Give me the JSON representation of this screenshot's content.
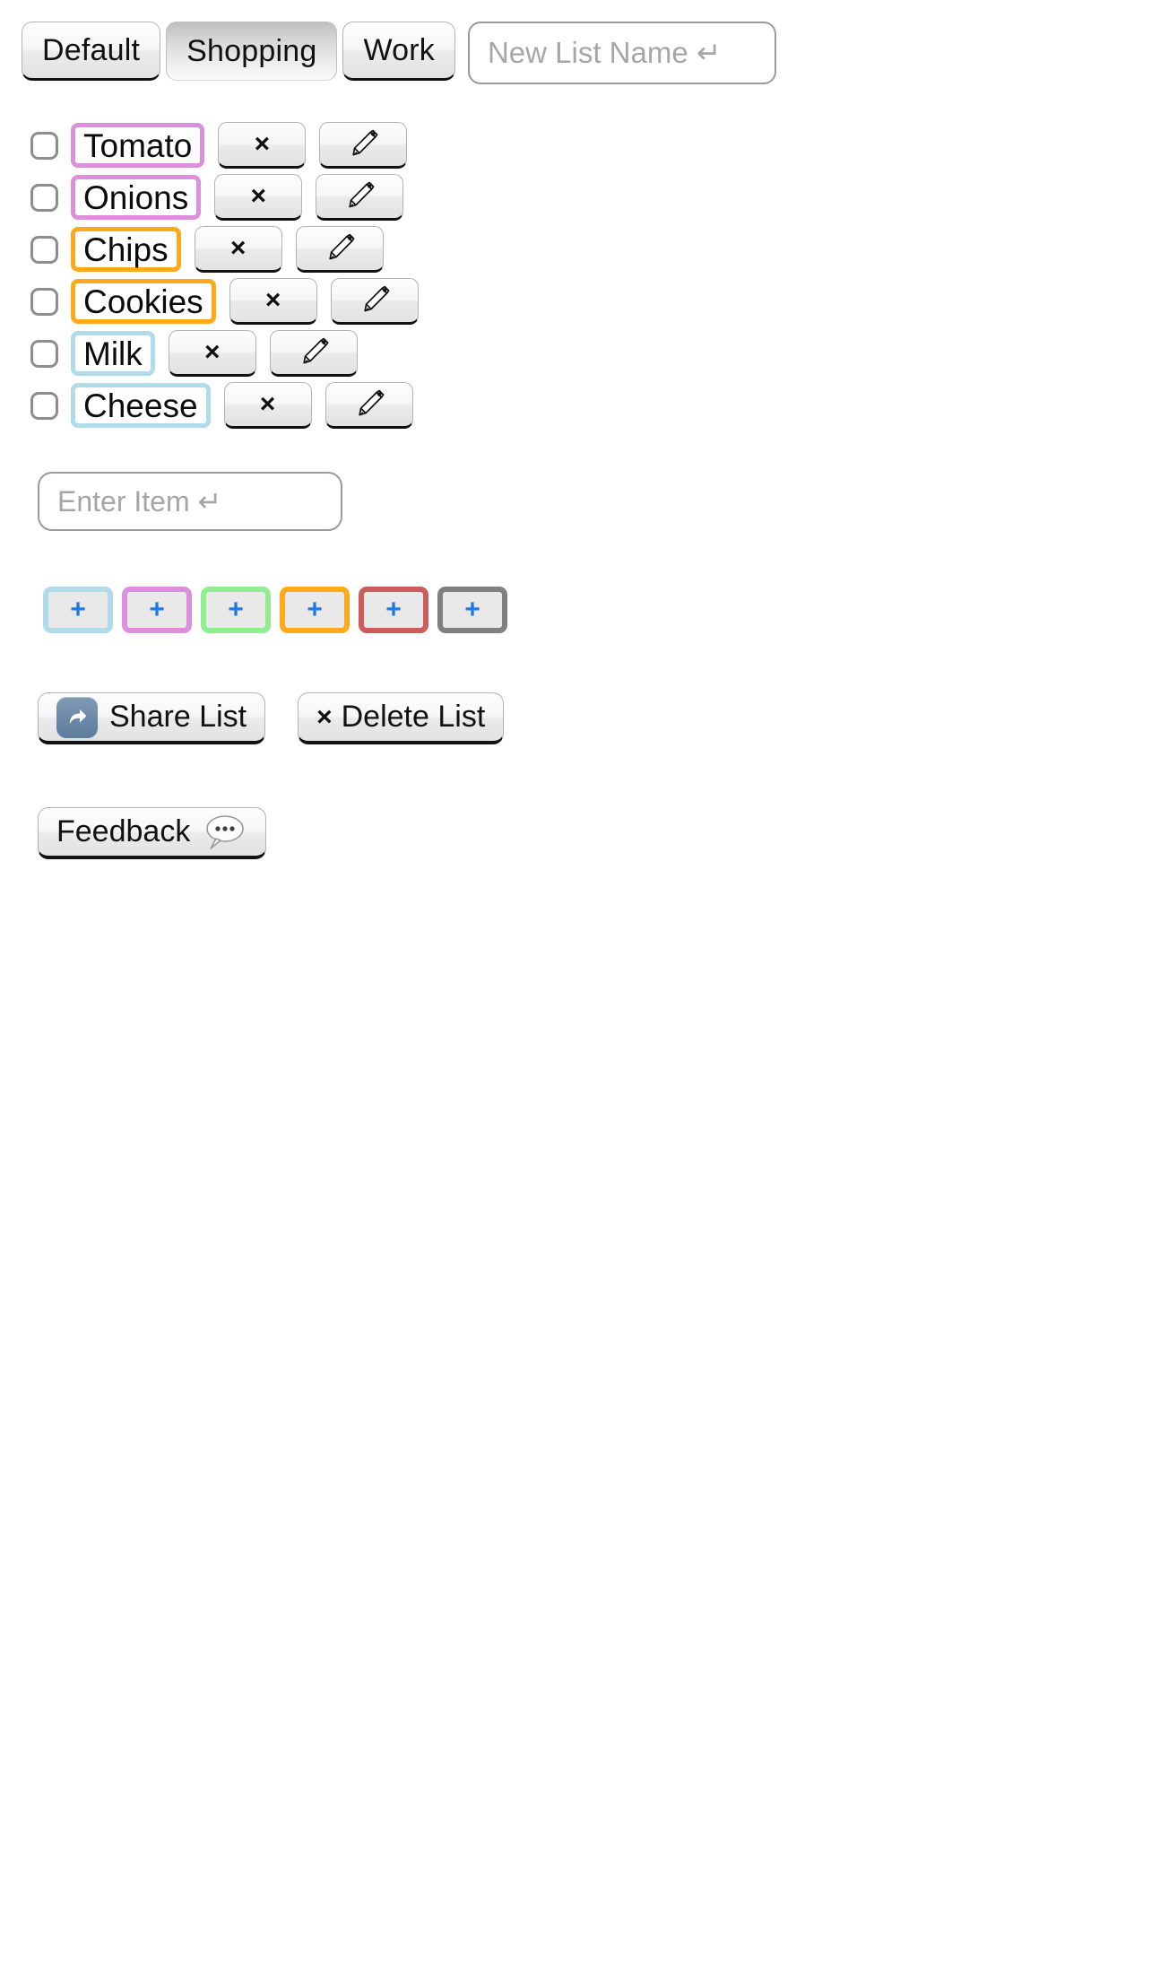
{
  "tabs": {
    "items": [
      {
        "label": "Default",
        "active": false
      },
      {
        "label": "Shopping",
        "active": true
      },
      {
        "label": "Work",
        "active": false
      }
    ],
    "new_list_input": {
      "value": "",
      "placeholder": "New List Name ↵"
    }
  },
  "items": {
    "rows": [
      {
        "name": "Tomato",
        "color": "#dd8fdd",
        "checked": false,
        "delete_label": "×"
      },
      {
        "name": "Onions",
        "color": "#dd8fdd",
        "checked": false,
        "delete_label": "×"
      },
      {
        "name": "Chips",
        "color": "#ffa819",
        "checked": false,
        "delete_label": "×"
      },
      {
        "name": "Cookies",
        "color": "#ffa819",
        "checked": false,
        "delete_label": "×"
      },
      {
        "name": "Milk",
        "color": "#b0dbe8",
        "checked": false,
        "delete_label": "×"
      },
      {
        "name": "Cheese",
        "color": "#b0dbe8",
        "checked": false,
        "delete_label": "×"
      }
    ]
  },
  "enter_item_input": {
    "value": "",
    "placeholder": "Enter Item ↵"
  },
  "color_picker": {
    "add_label": "+",
    "swatches": [
      {
        "color": "#b0dbe8",
        "name": "lightblue"
      },
      {
        "color": "#dd8fdd",
        "name": "pink"
      },
      {
        "color": "#90ee90",
        "name": "green"
      },
      {
        "color": "#ffa819",
        "name": "orange"
      },
      {
        "color": "#cd5c5c",
        "name": "red"
      },
      {
        "color": "#808080",
        "name": "gray"
      }
    ]
  },
  "actions": {
    "share_label": "Share List",
    "delete_prefix": "×",
    "delete_label": "Delete List",
    "feedback_label": "Feedback"
  },
  "accent": {
    "plus_blue": "#1a7ae8",
    "share_icon_bg": "#6d8aa8"
  }
}
